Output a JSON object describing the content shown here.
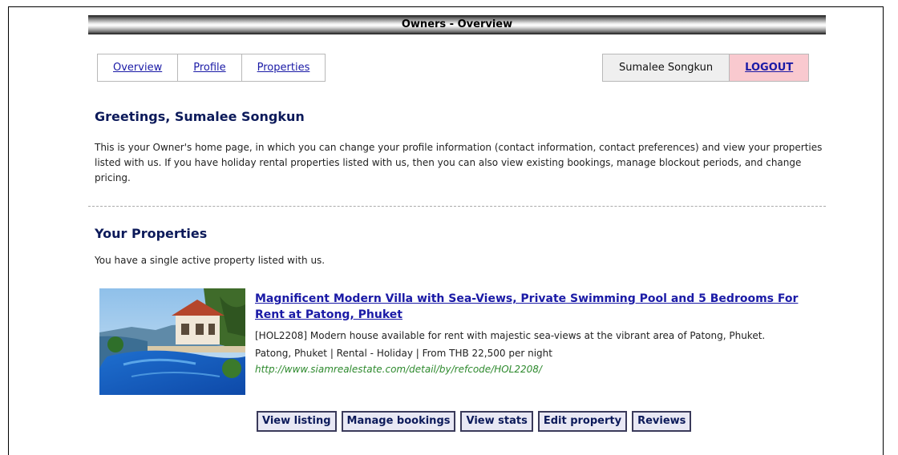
{
  "header": {
    "title": "Owners - Overview"
  },
  "nav": {
    "items": [
      {
        "label": "Overview"
      },
      {
        "label": "Profile"
      },
      {
        "label": "Properties"
      }
    ]
  },
  "user": {
    "name": "Sumalee Songkun",
    "logout_label": "LOGOUT"
  },
  "main": {
    "greeting": "Greetings, Sumalee Songkun",
    "intro": "This is your Owner's home page, in which you can change your profile information (contact information, contact preferences) and view your properties listed with us. If you have holiday rental properties listed with us, then you can also view existing bookings, manage blockout periods, and change pricing.",
    "properties_heading": "Your Properties",
    "properties_count_text": "You have a single active property listed with us."
  },
  "listing": {
    "title": "Magnificent Modern Villa with Sea-Views, Private Swimming Pool and 5 Bedrooms For Rent at Patong, Phuket",
    "description": "[HOL2208] Modern house available for rent with majestic sea-views at the vibrant area of Patong, Phuket.",
    "meta": "Patong, Phuket | Rental - Holiday | From THB 22,500 per night",
    "url": "http://www.siamrealestate.com/detail/by/refcode/HOL2208/"
  },
  "actions": {
    "view_listing": "View listing",
    "manage_bookings": "Manage bookings",
    "view_stats": "View stats",
    "edit_property": "Edit property",
    "reviews": "Reviews"
  }
}
